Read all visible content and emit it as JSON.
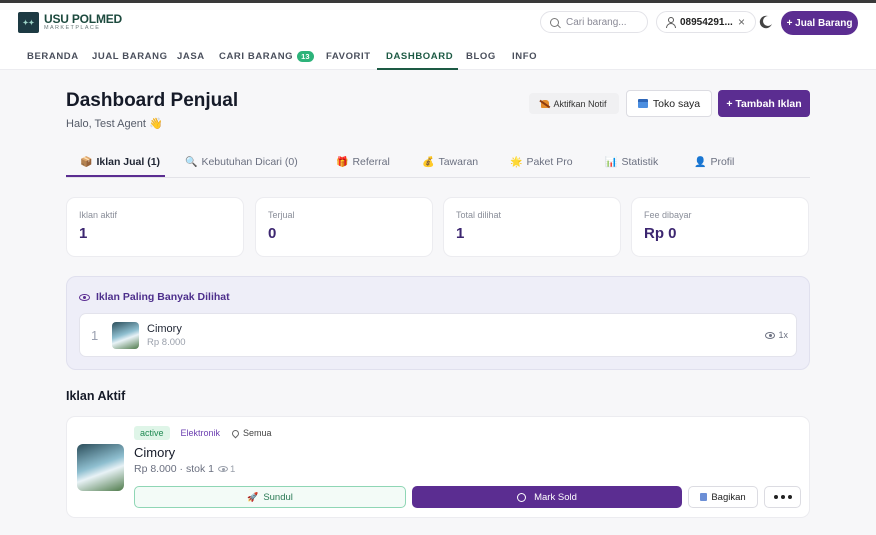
{
  "header": {
    "logo_title": "USU POLMED",
    "logo_sub": "MARKETPLACE",
    "search_placeholder": "Cari barang...",
    "user_phone": "08954291...",
    "clear_icon": "×",
    "sell_button": "+ Jual Barang"
  },
  "nav": {
    "items": [
      "BERANDA",
      "JUAL BARANG",
      "JASA",
      "CARI BARANG",
      "FAVORIT",
      "DASHBOARD",
      "BLOG",
      "INFO"
    ],
    "cari_badge": "13",
    "active": "DASHBOARD"
  },
  "page": {
    "title": "Dashboard Penjual",
    "greeting": "Halo, Test Agent 👋",
    "notif_button": "Aktifkan Notif",
    "shop_button": "Toko saya",
    "add_button": "+ Tambah Iklan"
  },
  "tabs": [
    {
      "icon": "📦",
      "label": "Iklan Jual (1)",
      "active": true
    },
    {
      "icon": "🔍",
      "label": "Kebutuhan Dicari (0)"
    },
    {
      "icon": "🎁",
      "label": "Referral"
    },
    {
      "icon": "💰",
      "label": "Tawaran"
    },
    {
      "icon": "🌟",
      "label": "Paket Pro"
    },
    {
      "icon": "📊",
      "label": "Statistik"
    },
    {
      "icon": "👤",
      "label": "Profil"
    }
  ],
  "stats": [
    {
      "label": "Iklan aktif",
      "value": "1"
    },
    {
      "label": "Terjual",
      "value": "0"
    },
    {
      "label": "Total dilihat",
      "value": "1"
    },
    {
      "label": "Fee dibayar",
      "value": "Rp 0"
    }
  ],
  "popular": {
    "title": "Iklan Paling Banyak Dilihat",
    "items": [
      {
        "rank": "1",
        "name": "Cimory",
        "price": "Rp 8.000",
        "views": "1x"
      }
    ]
  },
  "active_ads": {
    "title": "Iklan Aktif",
    "items": [
      {
        "status": "active",
        "category": "Elektronik",
        "location": "Semua",
        "name": "Cimory",
        "meta": "Rp 8.000 · stok 1",
        "views": "1",
        "sundul_label": "Sundul",
        "sold_label": "Mark Sold",
        "share_label": "Bagikan"
      }
    ]
  },
  "colors": {
    "accent": "#5b2d91",
    "brand_green": "#1d5a44",
    "stat_value": "#3c2670"
  }
}
